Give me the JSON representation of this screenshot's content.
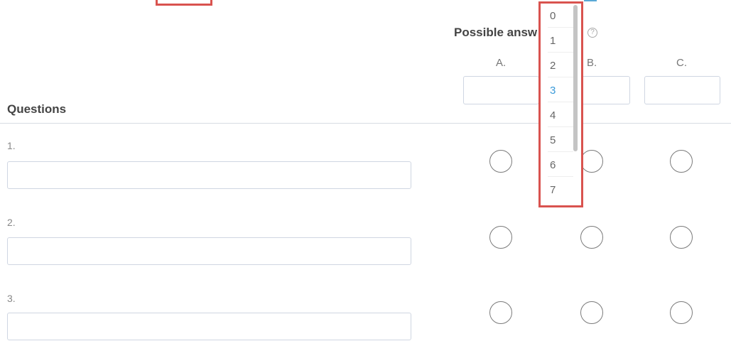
{
  "answers_header": {
    "label": "Possible answers",
    "help_icon": "question-circle-icon"
  },
  "answer_columns": [
    {
      "letter": "A.",
      "value": ""
    },
    {
      "letter": "B.",
      "value": ""
    },
    {
      "letter": "C.",
      "value": ""
    }
  ],
  "questions": {
    "heading": "Questions",
    "items": [
      {
        "number": "1.",
        "value": ""
      },
      {
        "number": "2.",
        "value": ""
      },
      {
        "number": "3.",
        "value": ""
      }
    ]
  },
  "dropdown": {
    "options": [
      "0",
      "1",
      "2",
      "3",
      "4",
      "5",
      "6",
      "7"
    ],
    "selected": "3"
  },
  "colors": {
    "highlight": "#d9534f",
    "selected_option": "#3a9ad9"
  }
}
